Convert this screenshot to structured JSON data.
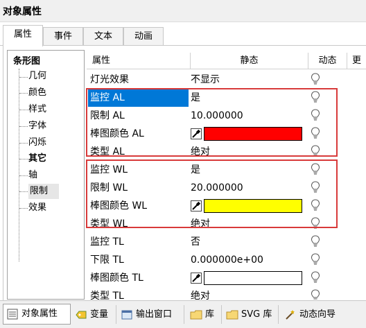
{
  "window": {
    "title": "对象属性"
  },
  "tabs": [
    {
      "label": "属性",
      "active": true
    },
    {
      "label": "事件"
    },
    {
      "label": "文本"
    },
    {
      "label": "动画"
    }
  ],
  "tree": {
    "root": "条形图",
    "items": [
      {
        "label": "几何"
      },
      {
        "label": "颜色"
      },
      {
        "label": "样式"
      },
      {
        "label": "字体"
      },
      {
        "label": "闪烁"
      },
      {
        "label": "其它",
        "bold": true
      },
      {
        "label": "轴"
      },
      {
        "label": "限制",
        "selected": true
      },
      {
        "label": "效果"
      }
    ]
  },
  "grid": {
    "headers": {
      "property": "属性",
      "static": "静态",
      "dynamic": "动态",
      "more": "更"
    },
    "rows": [
      {
        "name": "灯光效果",
        "value": "不显示"
      },
      {
        "name": "监控 AL",
        "value": "是",
        "selected": true
      },
      {
        "name": "限制 AL",
        "value": "10.000000"
      },
      {
        "name": "棒图颜色 AL",
        "color": "#ff0000"
      },
      {
        "name": "类型 AL",
        "value": "绝对"
      },
      {
        "name": "监控 WL",
        "value": "是"
      },
      {
        "name": "限制 WL",
        "value": "20.000000"
      },
      {
        "name": "棒图颜色 WL",
        "color": "#ffff00"
      },
      {
        "name": "类型 WL",
        "value": "绝对"
      },
      {
        "name": "监控 TL",
        "value": "否"
      },
      {
        "name": "下限 TL",
        "value": "0.000000e+00"
      },
      {
        "name": "棒图颜色 TL",
        "color": "#ffffff"
      },
      {
        "name": "类型 TL",
        "value": "绝对"
      }
    ]
  },
  "bottom_tabs": [
    {
      "label": "对象属性",
      "icon": "properties-icon",
      "active": true
    },
    {
      "label": "变量",
      "icon": "tag-icon"
    },
    {
      "label": "输出窗口",
      "icon": "output-window-icon"
    },
    {
      "label": "库",
      "icon": "folder-icon"
    },
    {
      "label": "SVG 库",
      "icon": "svg-folder-icon"
    },
    {
      "label": "动态向导",
      "icon": "wizard-icon"
    }
  ],
  "colors": {
    "highlight_box": "#d83a3a",
    "selection": "#0078d7"
  }
}
